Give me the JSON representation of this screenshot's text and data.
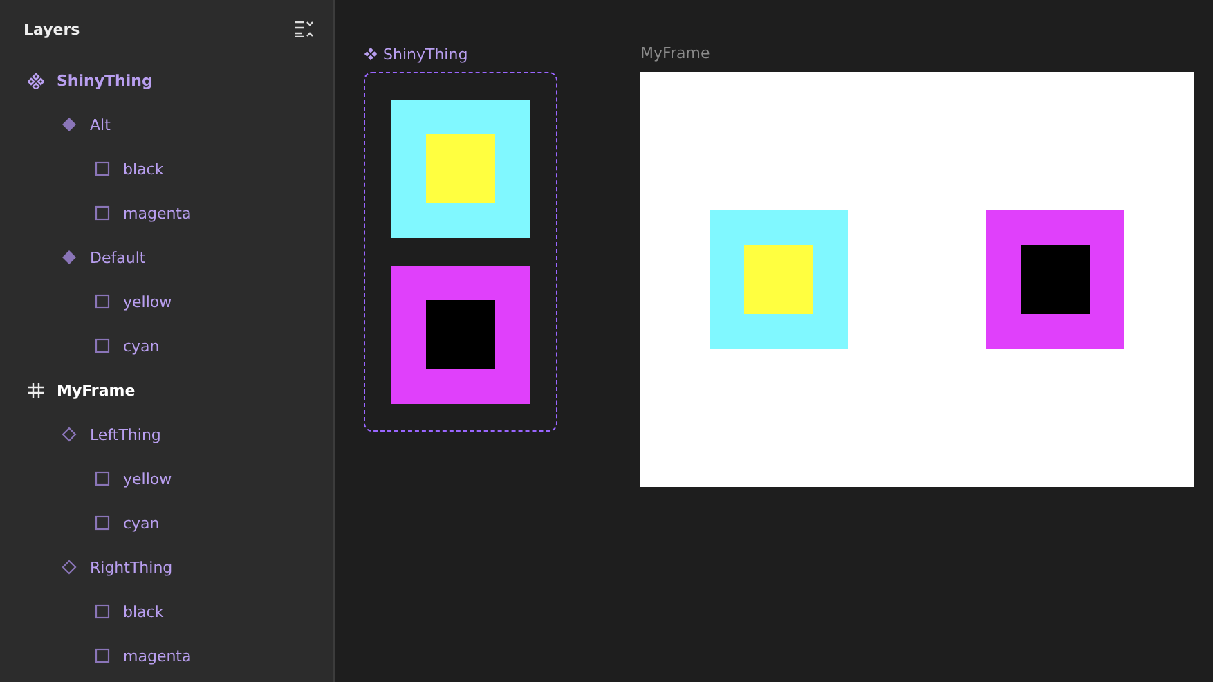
{
  "sidebar": {
    "title": "Layers",
    "layers": [
      {
        "name": "ShinyThing",
        "kind": "component-set",
        "children": [
          {
            "name": "Alt",
            "kind": "variant",
            "children": [
              {
                "name": "black",
                "kind": "rectangle"
              },
              {
                "name": "magenta",
                "kind": "rectangle"
              }
            ]
          },
          {
            "name": "Default",
            "kind": "variant",
            "children": [
              {
                "name": "yellow",
                "kind": "rectangle"
              },
              {
                "name": "cyan",
                "kind": "rectangle"
              }
            ]
          }
        ]
      },
      {
        "name": "MyFrame",
        "kind": "frame",
        "children": [
          {
            "name": "LeftThing",
            "kind": "instance",
            "children": [
              {
                "name": "yellow",
                "kind": "rectangle"
              },
              {
                "name": "cyan",
                "kind": "rectangle"
              }
            ]
          },
          {
            "name": "RightThing",
            "kind": "instance",
            "children": [
              {
                "name": "black",
                "kind": "rectangle"
              },
              {
                "name": "magenta",
                "kind": "rectangle"
              }
            ]
          }
        ]
      }
    ]
  },
  "canvas": {
    "component_set": {
      "label": "ShinyThing",
      "variants": [
        {
          "layers": [
            {
              "color": "#80f8ff"
            },
            {
              "color": "#ffff40"
            }
          ]
        },
        {
          "layers": [
            {
              "color": "#e040fb"
            },
            {
              "color": "#000000"
            }
          ]
        }
      ]
    },
    "frame": {
      "label": "MyFrame",
      "instances": [
        {
          "layers": [
            {
              "color": "#80f8ff"
            },
            {
              "color": "#ffff40"
            }
          ]
        },
        {
          "layers": [
            {
              "color": "#e040fb"
            },
            {
              "color": "#000000"
            }
          ]
        }
      ]
    }
  }
}
